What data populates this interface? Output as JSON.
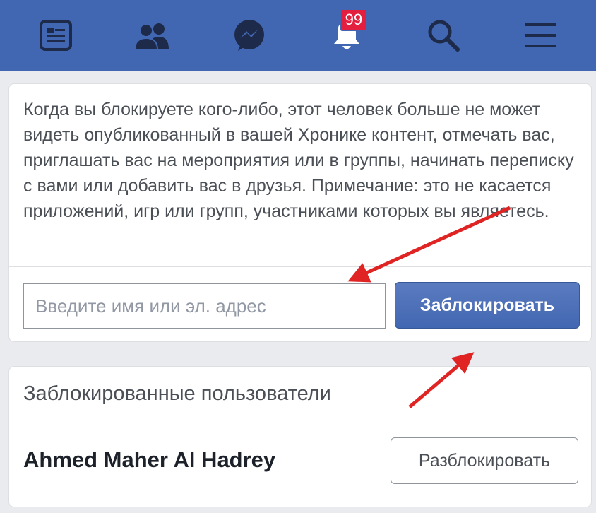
{
  "nav": {
    "icons": [
      "news-feed-icon",
      "friends-icon",
      "messenger-icon",
      "notifications-icon",
      "search-icon",
      "menu-icon"
    ],
    "notification_count": "99"
  },
  "block_panel": {
    "description": "Когда вы блокируете кого-либо, этот человек больше не может видеть опубликованный в вашей Хронике контент, отмечать вас, приглашать вас на мероприятия или в группы, начинать переписку с вами или добавить вас в друзья. Примечание: это не касается приложений, игр или групп, участниками которых вы являетесь.",
    "input_placeholder": "Введите имя или эл. адрес",
    "input_value": "",
    "block_button_label": "Заблокировать"
  },
  "blocked_users": {
    "title": "Заблокированные пользователи",
    "users": [
      {
        "name": "Ahmed Maher Al Hadrey",
        "unblock_label": "Разблокировать"
      }
    ]
  },
  "colors": {
    "brand": "#4267b2",
    "badge": "#e41e3f",
    "annotation_arrow": "#e02424"
  }
}
